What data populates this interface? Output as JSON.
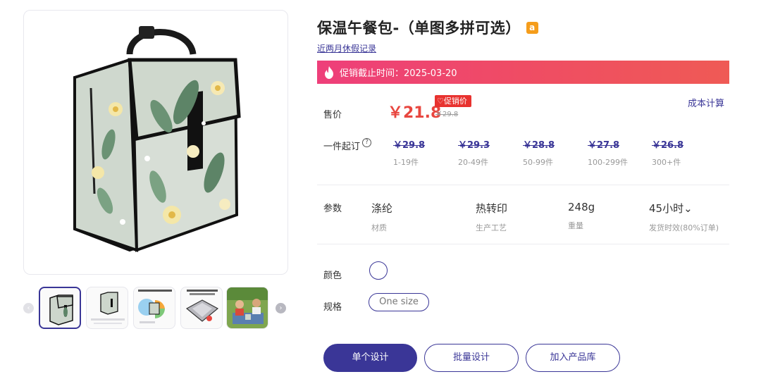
{
  "product": {
    "title": "保温午餐包-（单图多拼可选）",
    "marketplace_badge": "a",
    "holiday_link": "近两月休假记录"
  },
  "promo": {
    "text": "促销截止时间：2025-03-20",
    "icon": "flame-icon"
  },
  "price": {
    "label": "售价",
    "current": "￥21.8",
    "original": "￥29.8",
    "tag": "促销价",
    "cost_link": "成本计算"
  },
  "tiers": {
    "label": "一件起订",
    "help": "?",
    "items": [
      {
        "price": "￥29.8",
        "qty": "1-19件"
      },
      {
        "price": "￥29.3",
        "qty": "20-49件"
      },
      {
        "price": "￥28.8",
        "qty": "50-99件"
      },
      {
        "price": "￥27.8",
        "qty": "100-299件"
      },
      {
        "price": "￥26.8",
        "qty": "300+件"
      }
    ]
  },
  "params": {
    "label": "参数",
    "items": [
      {
        "value": "涤纶",
        "key": "材质"
      },
      {
        "value": "热转印",
        "key": "生产工艺"
      },
      {
        "value": "248g",
        "key": "重量"
      },
      {
        "value": "45小时⌄",
        "key": "发货时效(80%订单)"
      }
    ]
  },
  "color": {
    "label": "颜色",
    "selected": "#ffffff"
  },
  "spec": {
    "label": "规格",
    "option": "One size"
  },
  "actions": {
    "single": "单个设计",
    "batch": "批量设计",
    "add_library": "加入产品库"
  },
  "gallery": {
    "thumb_count": 5,
    "arrow_left": "‹",
    "arrow_right": "›"
  },
  "colors": {
    "accent": "#3a3697",
    "price_red": "#e8463f",
    "promo_gradient_start": "#ee3f7a",
    "promo_gradient_end": "#ef5a55"
  }
}
